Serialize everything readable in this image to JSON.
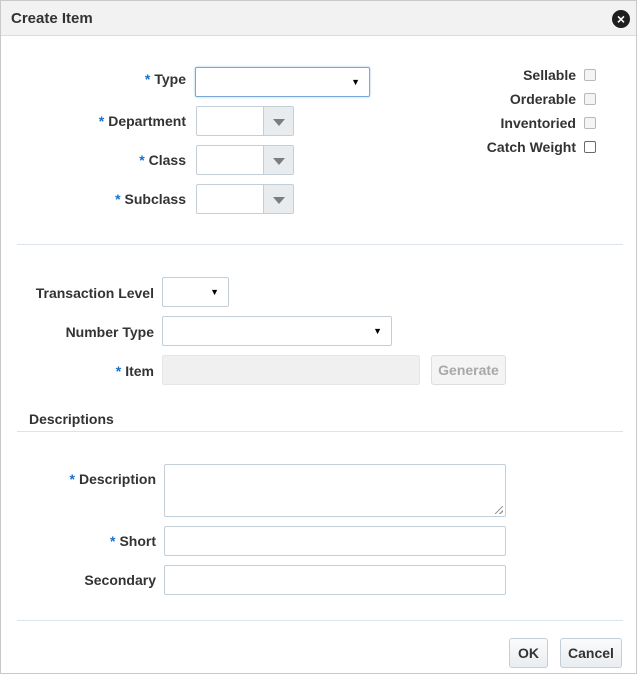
{
  "dialog": {
    "title": "Create Item",
    "close_icon": "close-icon"
  },
  "classification": {
    "type_label": "Type",
    "type_value": "",
    "department_label": "Department",
    "department_value": "",
    "class_label": "Class",
    "class_value": "",
    "subclass_label": "Subclass",
    "subclass_value": "",
    "required_marker": "*"
  },
  "flags": {
    "sellable": {
      "label": "Sellable",
      "checked": false
    },
    "orderable": {
      "label": "Orderable",
      "checked": false
    },
    "inventoried": {
      "label": "Inventoried",
      "checked": false
    },
    "catch_weight": {
      "label": "Catch Weight",
      "checked": false
    }
  },
  "item": {
    "transaction_level_label": "Transaction Level",
    "transaction_level_value": "",
    "number_type_label": "Number Type",
    "number_type_value": "",
    "item_label": "Item",
    "item_value": "",
    "generate_label": "Generate"
  },
  "descriptions": {
    "section_title": "Descriptions",
    "description_label": "Description",
    "description_value": "",
    "short_label": "Short",
    "short_value": "",
    "secondary_label": "Secondary",
    "secondary_value": ""
  },
  "footer": {
    "ok_label": "OK",
    "cancel_label": "Cancel"
  },
  "colors": {
    "required": "#1a6fc9",
    "titlebar": "#f2f2f2",
    "border": "#c4ced7"
  }
}
